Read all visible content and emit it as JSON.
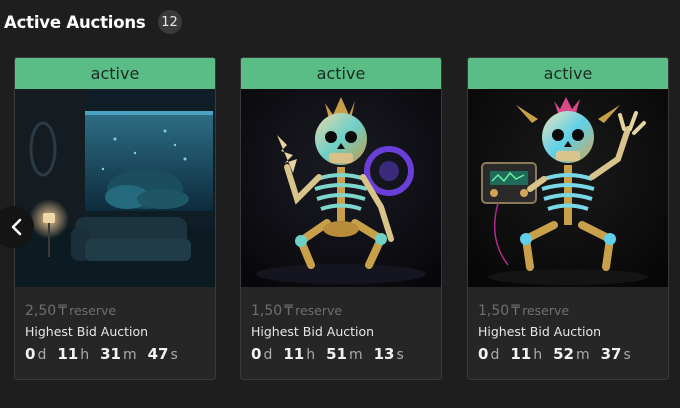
{
  "header": {
    "title": "Active Auctions",
    "count": "12"
  },
  "cards": [
    {
      "status": "active",
      "reserve_value": "2,50",
      "currency_icon": "tenge-sign-icon",
      "currency_symbol": "₸",
      "reserve_label": "reserve",
      "auction_type": "Highest Bid Auction",
      "days": "0",
      "hours": "11",
      "minutes": "31",
      "seconds": "47",
      "image": "aquarium-living-room-image"
    },
    {
      "status": "active",
      "reserve_value": "1,50",
      "currency_icon": "tenge-sign-icon",
      "currency_symbol": "₸",
      "reserve_label": "reserve",
      "auction_type": "Highest Bid Auction",
      "days": "0",
      "hours": "11",
      "minutes": "51",
      "seconds": "13",
      "image": "neon-skeleton-sitting-image"
    },
    {
      "status": "active",
      "reserve_value": "1,50",
      "currency_icon": "tenge-sign-icon",
      "currency_symbol": "₸",
      "reserve_label": "reserve",
      "auction_type": "Highest Bid Auction",
      "days": "0",
      "hours": "11",
      "minutes": "52",
      "seconds": "37",
      "image": "neon-skeleton-boombox-image"
    }
  ],
  "units": {
    "days": "d",
    "hours": "h",
    "minutes": "m",
    "seconds": "s"
  },
  "navigation": {
    "prev_icon": "chevron-left-icon"
  },
  "colors": {
    "status_active": "#5bbd86",
    "card_bg": "#262626",
    "page_bg": "#1e1e1e"
  }
}
